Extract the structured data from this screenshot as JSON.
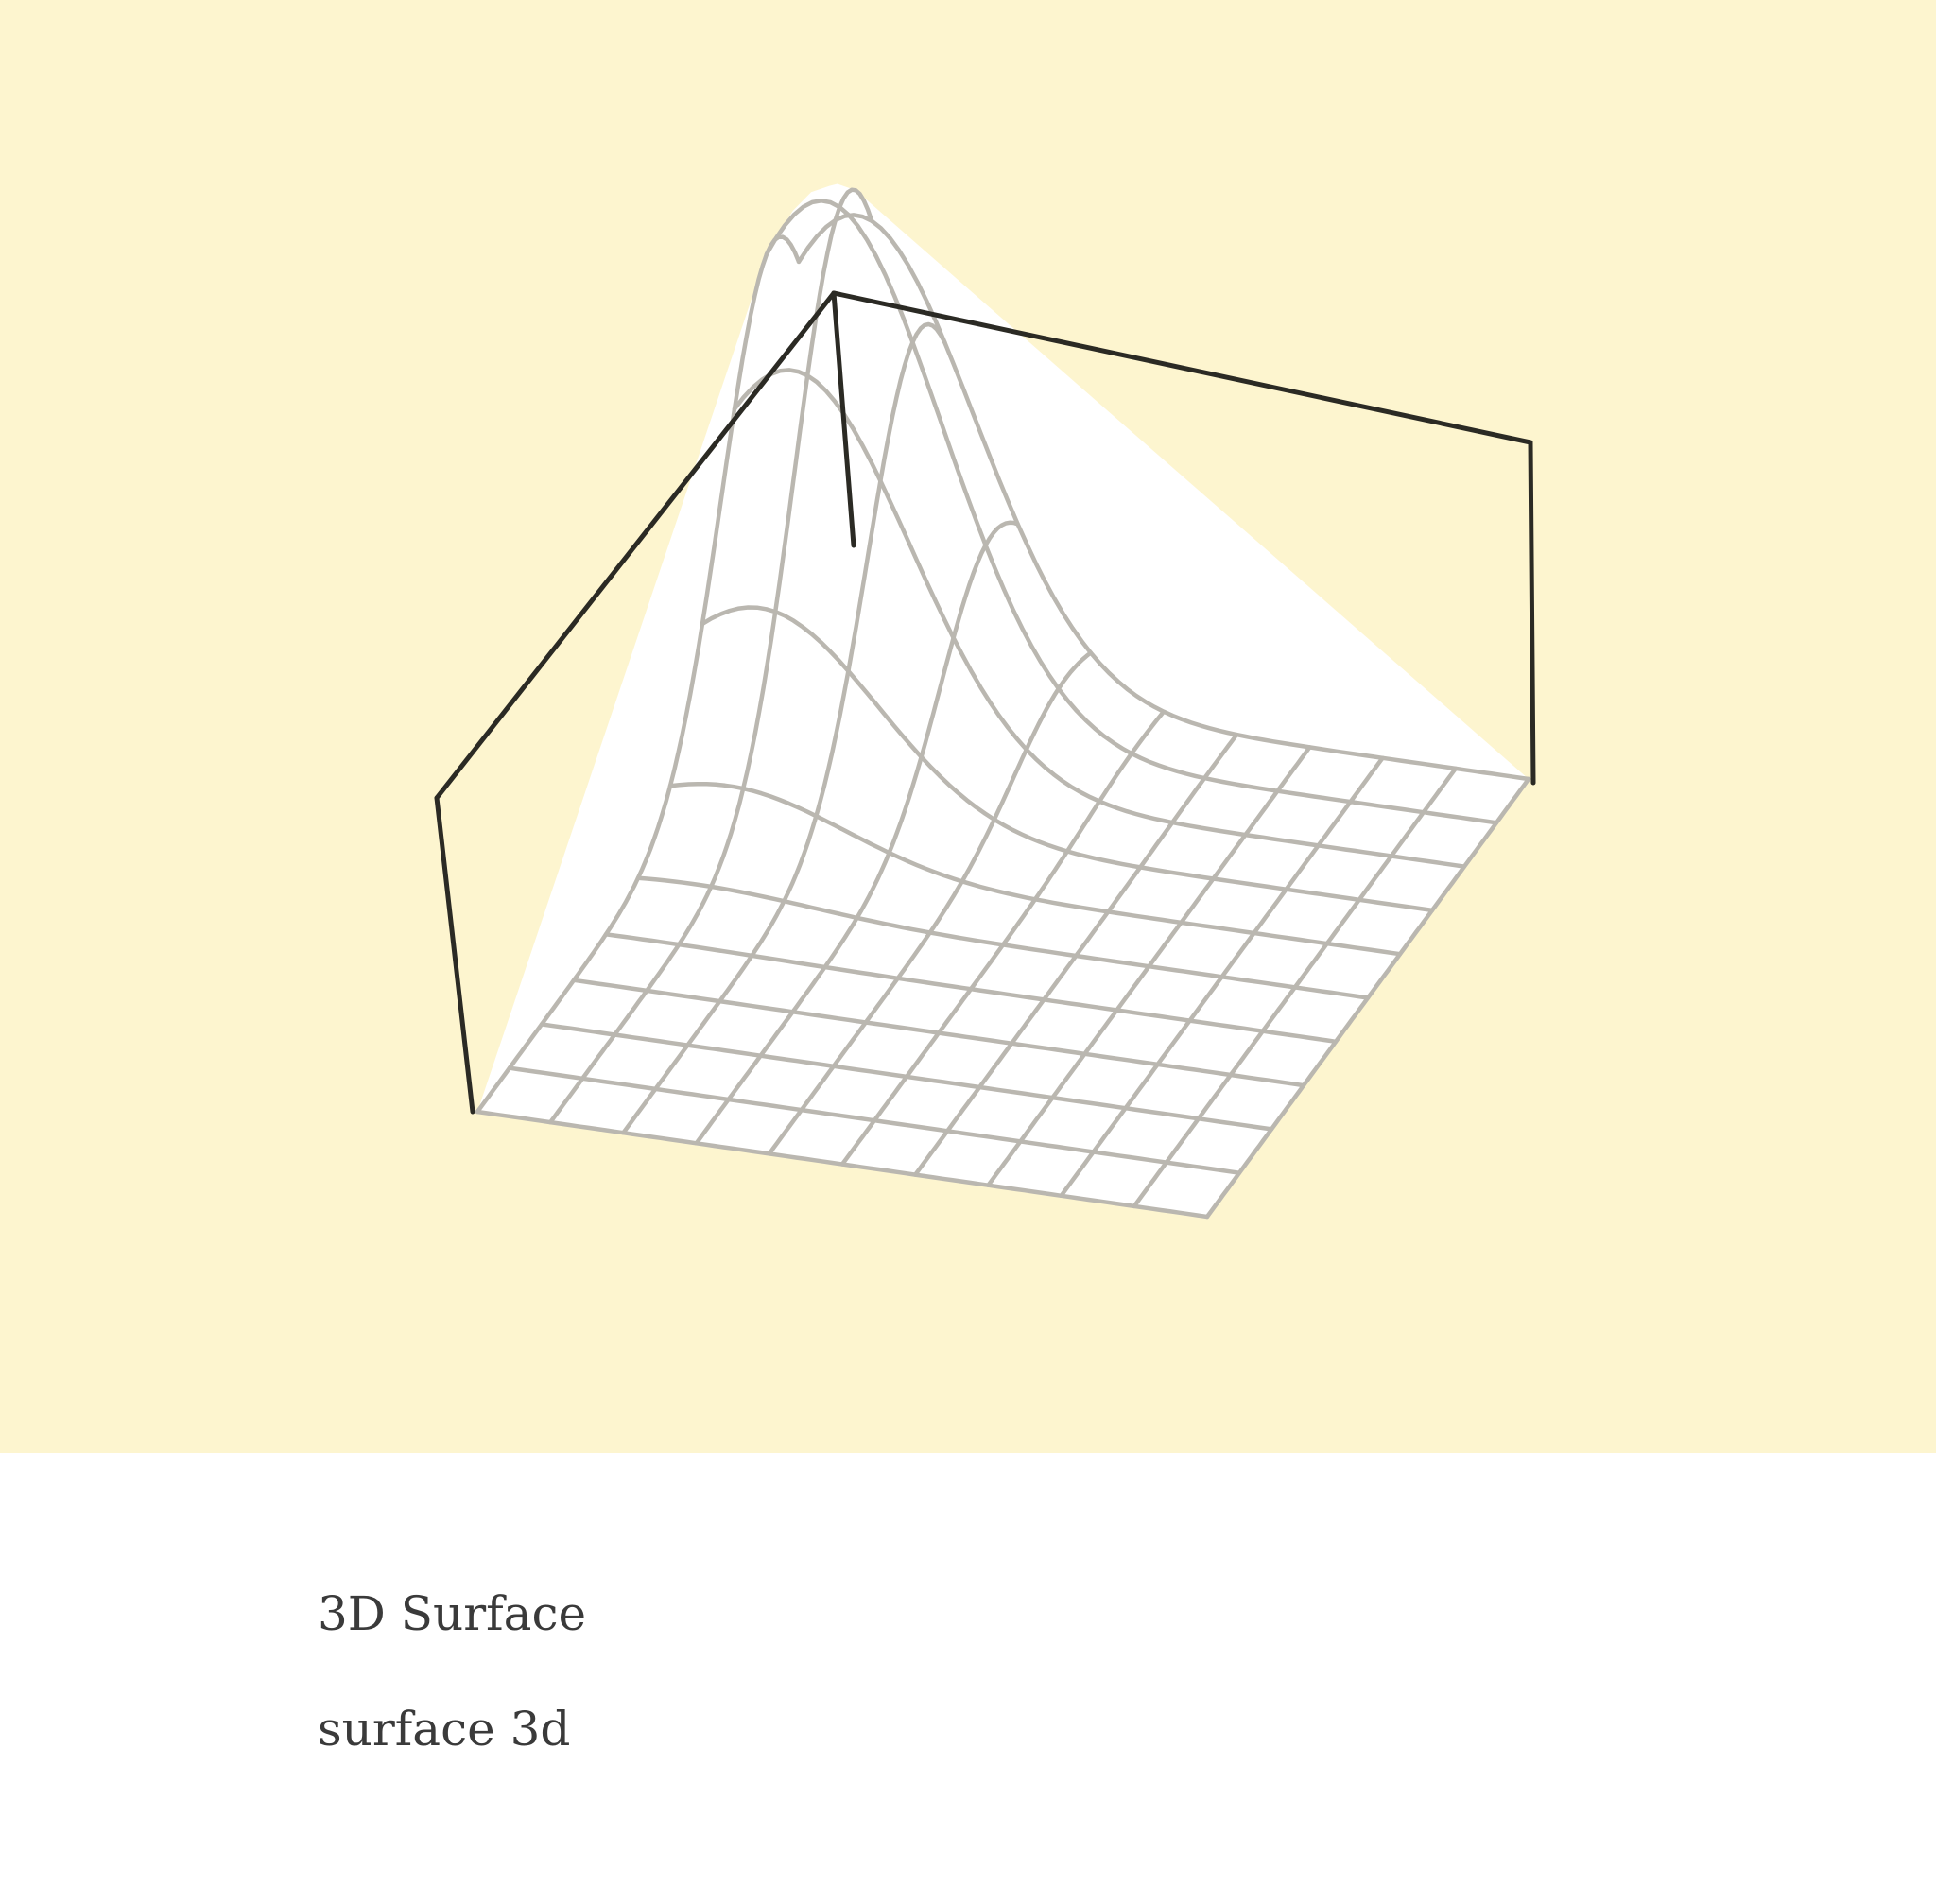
{
  "illustration": {
    "subject": "3d-surface-wireframe",
    "background_color": "#fdf5cf",
    "frame_color": "#2b2a24",
    "mesh_color": "#bab7b0",
    "surface_fill": "#ffffff"
  },
  "caption": {
    "title": "3D Surface",
    "subtitle": "surface 3d"
  }
}
